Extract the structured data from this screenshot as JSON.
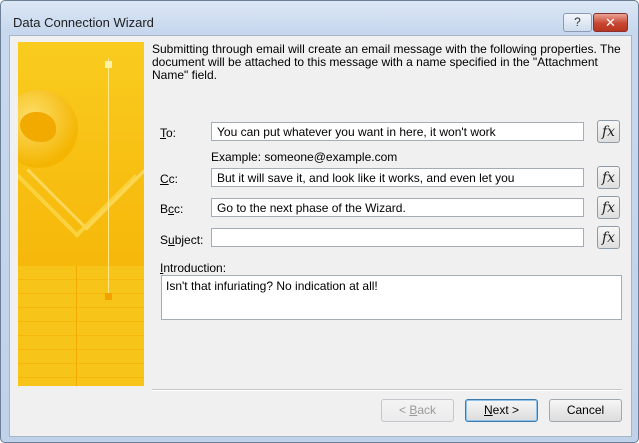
{
  "window": {
    "title": "Data Connection Wizard"
  },
  "titlebar": {
    "help_label": "?",
    "close_label": "✕"
  },
  "description": "Submitting through email will create an email message with the following properties. The document will be attached to this message with a name specified in the \"Attachment Name\" field.",
  "fields": {
    "to": {
      "label_key": "T",
      "label_rest": "o:",
      "value": "You can put whatever you want in here, it won't work"
    },
    "cc": {
      "label_key": "C",
      "label_rest": "c:",
      "value": "But it will save it, and look like it works, and even let you"
    },
    "bcc": {
      "label_pre": "B",
      "label_key": "c",
      "label_rest": "c:",
      "value": "Go to the next phase of the Wizard."
    },
    "subject": {
      "label_pre": "S",
      "label_key": "u",
      "label_rest": "bject:",
      "value": ""
    }
  },
  "example": "Example: someone@example.com",
  "fx_label": "fx",
  "introduction": {
    "label_key": "I",
    "label_rest": "ntroduction:",
    "value": "Isn't that infuriating? No indication at all!"
  },
  "buttons": {
    "back": {
      "pre": "< ",
      "key": "B",
      "rest": "ack"
    },
    "next": {
      "key": "N",
      "rest": "ext >"
    },
    "cancel": "Cancel"
  }
}
